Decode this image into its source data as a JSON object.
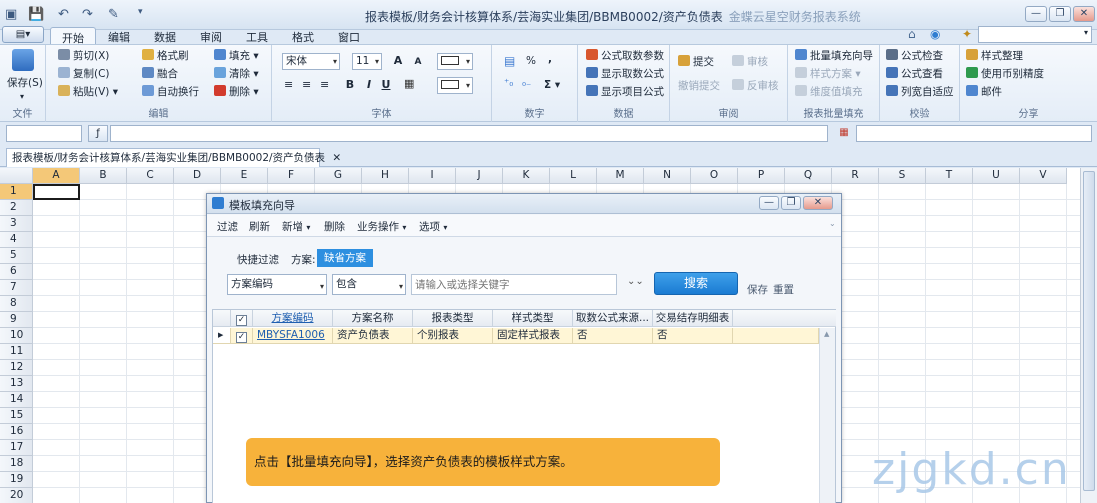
{
  "window": {
    "title": "报表模板/财务会计核算体系/芸海实业集团/BBMB0002/资产负债表",
    "app_name": "金蝶云星空财务报表系统",
    "min_label": "—",
    "max_label": "❐",
    "close_label": "✕"
  },
  "app_menu_label": "▤▾",
  "ribbon_tabs": [
    "开始",
    "编辑",
    "数据",
    "审阅",
    "工具",
    "格式",
    "窗口"
  ],
  "search_bar_placeholder": "",
  "ribbon": {
    "file": {
      "name": "文件",
      "save": "保存(S)"
    },
    "edit": {
      "name": "编辑",
      "cut": "剪切(X)",
      "copy": "复制(C)",
      "paste": "粘贴(V)",
      "format_brush": "格式刷",
      "merge": "融合",
      "wrap": "自动换行",
      "fill": "填充",
      "clear": "清除",
      "delete": "删除"
    },
    "font": {
      "name": "字体",
      "family": "宋体",
      "size": "11",
      "bold": "B",
      "italic": "I",
      "underline": "U",
      "grow": "A",
      "shrink": "A"
    },
    "number": {
      "name": "数字",
      "percent": "%",
      "comma": ",",
      "sum": "Σ"
    },
    "data": {
      "name": "数据",
      "fetch_params": "公式取数参数",
      "show_fetch": "显示取数公式",
      "show_item": "显示项目公式"
    },
    "review": {
      "name": "审阅",
      "submit": "提交",
      "withdraw": "撤销提交",
      "audit": "审核",
      "unaudit": "反审核"
    },
    "batch": {
      "name": "报表批量填充",
      "wizard": "批量填充向导",
      "style_plan": "样式方案",
      "dim_fill": "维度值填充"
    },
    "check": {
      "name": "校验",
      "formula_check": "公式检查",
      "formula_view": "公式查看",
      "col_width": "列宽自适应"
    },
    "share": {
      "name": "分享",
      "style_tidy": "样式整理",
      "currency": "使用币别精度",
      "mail": "邮件"
    }
  },
  "doc_tab": {
    "label": "报表模板/财务会计核算体系/芸海实业集团/BBMB0002/资产负债表",
    "close": "✕"
  },
  "columns": [
    "A",
    "B",
    "C",
    "D",
    "E",
    "F",
    "G",
    "H",
    "I",
    "J",
    "K",
    "L",
    "M",
    "N",
    "O",
    "P",
    "Q",
    "R",
    "S",
    "T",
    "U",
    "V"
  ],
  "rows": [
    "1",
    "2",
    "3",
    "4",
    "5",
    "6",
    "7",
    "8",
    "9",
    "10",
    "11",
    "12",
    "13",
    "14",
    "15",
    "16",
    "17",
    "18",
    "19",
    "20"
  ],
  "dialog": {
    "title": "模板填充向导",
    "toolbar": [
      "过滤",
      "刷新",
      "新增",
      "删除",
      "业务操作",
      "选项"
    ],
    "quick_filter": "快捷过滤",
    "plan_label": "方案:",
    "plan_value": "缺省方案",
    "field": "方案编码",
    "op": "包含",
    "keyword_placeholder": "请输入或选择关键字",
    "search": "搜索",
    "save": "保存",
    "reset": "重置",
    "headers": [
      "方案编码",
      "方案名称",
      "报表类型",
      "样式类型",
      "取数公式来源...",
      "交易结存明细表"
    ],
    "row": {
      "code": "MBYSFA1006",
      "name": "资产负债表",
      "report_type": "个别报表",
      "style_type": "固定样式报表",
      "formula_src": "否",
      "trade_detail": "否"
    }
  },
  "note": "点击【批量填充向导】，选择资产负债表的模板样式方案。",
  "watermark": "zjgkd.cn"
}
